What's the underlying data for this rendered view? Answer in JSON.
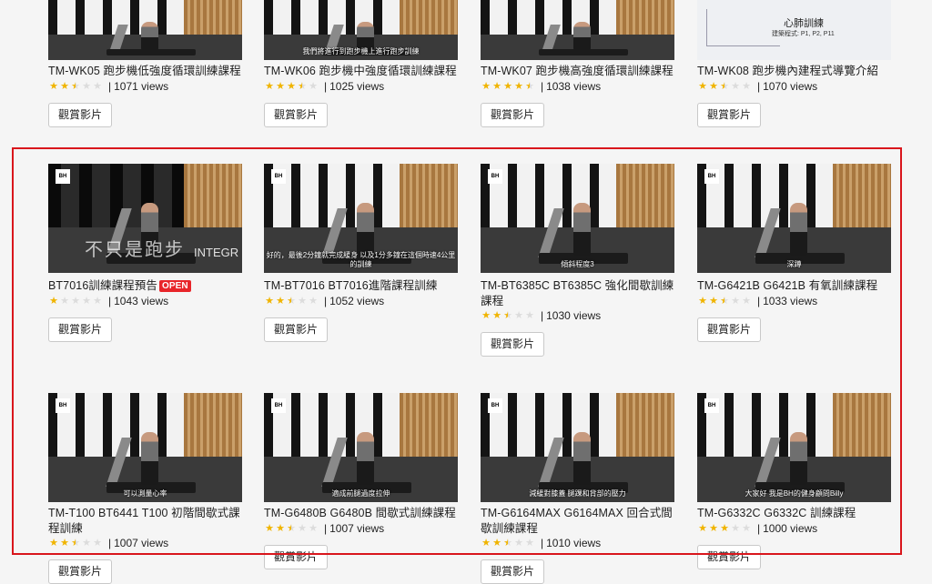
{
  "button_label": "觀賞影片",
  "views_suffix": "views",
  "top_row": [
    {
      "title": "TM-WK05 跑步機低強度循環訓練課程",
      "rating": 2.5,
      "views": "1071"
    },
    {
      "title": "TM-WK06 跑步機中強度循環訓練課程",
      "rating": 3.5,
      "views": "1025",
      "subtitle": "我們將進行到跑步機上進行跑步訓練"
    },
    {
      "title": "TM-WK07 跑步機高強度循環訓練課程",
      "rating": 4.5,
      "views": "1038"
    },
    {
      "title": "TM-WK08 跑步機內建程式導覽介紹",
      "rating": 2.5,
      "views": "1070",
      "thumb_title": "心肺訓練",
      "thumb_sub": "建築程式: P1, P2, P11"
    }
  ],
  "middle_row": [
    {
      "title": "BT7016訓練課程預告",
      "badge": "OPEN",
      "rating": 1,
      "views": "1043",
      "overlay": "不只是跑步",
      "overlay2": "INTEGR"
    },
    {
      "title": "TM-BT7016 BT7016進階課程訓練",
      "rating": 2.5,
      "views": "1052",
      "subtitle": "好的，最後2分鐘就完成緩身 以及1分多鐘在這個時速4公里的訓練"
    },
    {
      "title": "TM-BT6385C BT6385C 強化間歇訓練課程",
      "rating": 2.5,
      "views": "1030",
      "subtitle": "傾斜程度3"
    },
    {
      "title": "TM-G6421B G6421B 有氧訓練課程",
      "rating": 2.5,
      "views": "1033",
      "subtitle": "深蹲"
    }
  ],
  "bottom_row": [
    {
      "title": "TM-T100 BT6441 T100 初階間歇式課程訓練",
      "rating": 2.5,
      "views": "1007",
      "subtitle": "可以測量心率"
    },
    {
      "title": "TM-G6480B G6480B 間歇式訓練課程",
      "rating": 2.5,
      "views": "1007",
      "subtitle": "適成前腿過度拉伸"
    },
    {
      "title": "TM-G6164MAX G6164MAX 回合式間歇訓練課程",
      "rating": 2.5,
      "views": "1010",
      "subtitle": "減緩對膝蓋 腿踝和背部的壓力"
    },
    {
      "title": "TM-G6332C G6332C 訓練課程",
      "rating": 3,
      "views": "1000",
      "subtitle": "大家好 我是BH的健身顧問Billy"
    }
  ],
  "logo_text": "BH",
  "colors": {
    "highlight": "#d9161c",
    "star": "#f0b400",
    "badge": "#e8252a"
  }
}
